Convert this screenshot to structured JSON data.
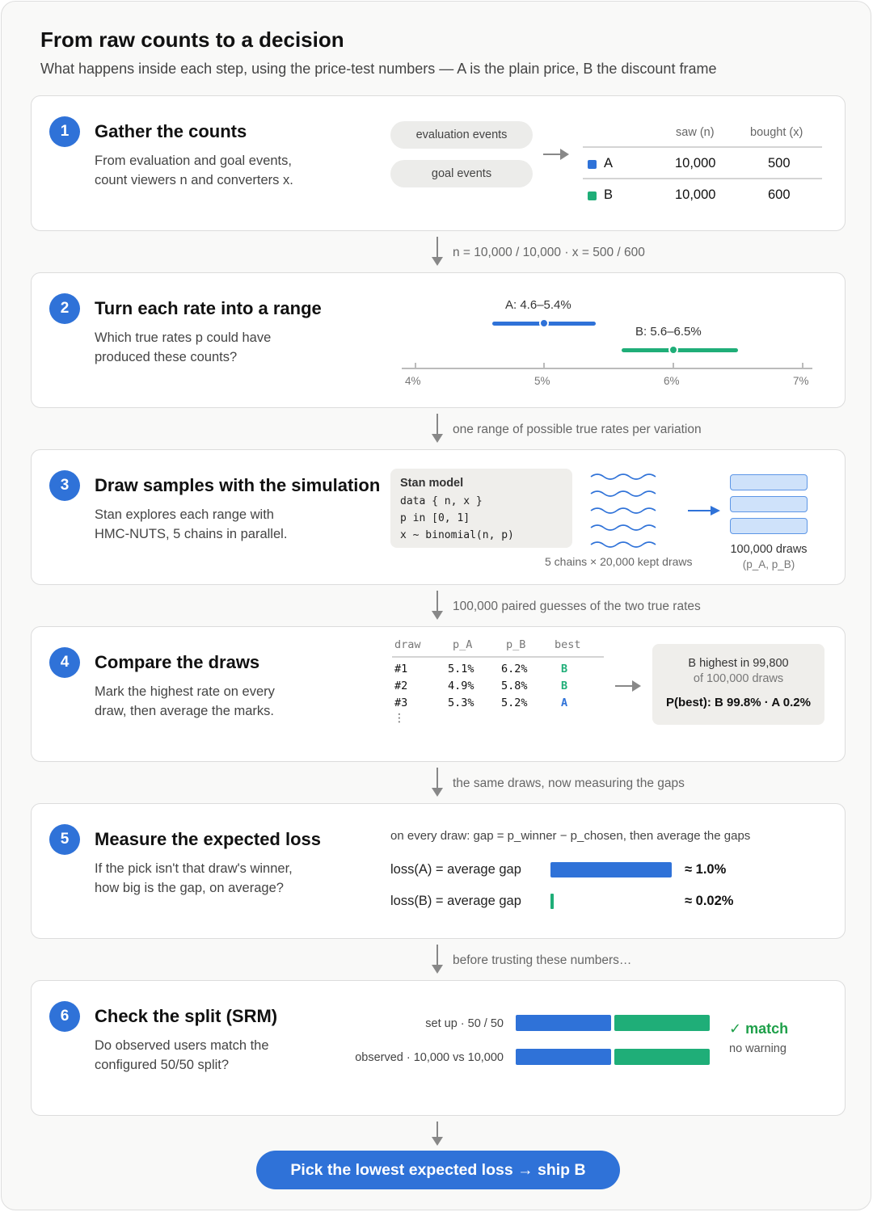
{
  "title": "From raw counts to a decision",
  "subtitle": "What happens inside each step, using the price-test numbers — A is the plain price, B the discount frame",
  "colors": {
    "accent": "#2f72d8",
    "variant_a": "#2f72d8",
    "variant_b": "#1fae78",
    "match": "#1fa04a"
  },
  "steps": [
    {
      "number": "1",
      "title": "Gather the counts",
      "desc": [
        "From evaluation and goal events,",
        "count viewers n and converters x."
      ],
      "sources": [
        "evaluation events",
        "goal events"
      ],
      "table": {
        "headers": [
          "saw (n)",
          "bought (x)"
        ],
        "rows": [
          {
            "variant": "A",
            "n": "10,000",
            "x": "500"
          },
          {
            "variant": "B",
            "n": "10,000",
            "x": "600"
          }
        ]
      }
    },
    {
      "number": "2",
      "title": "Turn each rate into a range",
      "desc": [
        "Which true rates p could have",
        "produced these counts?"
      ],
      "intervals": [
        {
          "label": "A: 4.6–5.4%",
          "low": 4.6,
          "mid": 5.0,
          "high": 5.4
        },
        {
          "label": "B: 5.6–6.5%",
          "low": 5.6,
          "mid": 6.0,
          "high": 6.5
        }
      ],
      "axis": {
        "min": 4,
        "max": 7,
        "ticks": [
          "4%",
          "5%",
          "6%",
          "7%"
        ]
      }
    },
    {
      "number": "3",
      "title": "Draw samples with the simulation",
      "desc": [
        "Stan explores each range with",
        "HMC-NUTS, 5 chains in parallel."
      ],
      "code_title": "Stan model",
      "code": [
        "data { n, x }",
        "p in [0, 1]",
        "x ~ binomial(n, p)"
      ],
      "chains_caption": "5 chains × 20,000 kept draws",
      "draws_caption": "100,000 draws",
      "draws_sub": "(p_A, p_B)"
    },
    {
      "number": "4",
      "title": "Compare the draws",
      "desc": [
        "Mark the highest rate on every",
        "draw, then average the marks."
      ],
      "table": {
        "headers": [
          "draw",
          "p_A",
          "p_B",
          "best"
        ],
        "rows": [
          {
            "draw": "#1",
            "pa": "5.1%",
            "pb": "6.2%",
            "best": "B"
          },
          {
            "draw": "#2",
            "pa": "4.9%",
            "pb": "5.8%",
            "best": "B"
          },
          {
            "draw": "#3",
            "pa": "5.3%",
            "pb": "5.2%",
            "best": "A"
          }
        ],
        "more": "⋮"
      },
      "result_line1": "B highest in 99,800",
      "result_line2": "of 100,000 draws",
      "result_summary": "P(best): B 99.8% · A 0.2%"
    },
    {
      "number": "5",
      "title": "Measure the expected loss",
      "desc": [
        "If the pick isn't that draw's winner,",
        "how big is the gap, on average?"
      ],
      "formula": "on every draw: gap = p_winner − p_chosen, then average the gaps",
      "losses": [
        {
          "label": "loss(A) = average gap",
          "value": "≈ 1.0%",
          "amount": 1.0
        },
        {
          "label": "loss(B) = average gap",
          "value": "≈ 0.02%",
          "amount": 0.02
        }
      ]
    },
    {
      "number": "6",
      "title": "Check the split (SRM)",
      "desc": [
        "Do observed users match the",
        "configured 50/50 split?"
      ],
      "rows": [
        {
          "label": "set up · 50 / 50",
          "share_a": 0.5
        },
        {
          "label": "observed · 10,000 vs 10,000",
          "share_a": 0.5
        }
      ],
      "status": "✓ match",
      "status_sub": "no warning"
    }
  ],
  "connectors": [
    "n = 10,000 / 10,000 · x = 500 / 600",
    "one range of possible true rates per variation",
    "100,000 paired guesses of the two true rates",
    "the same draws, now measuring the gaps",
    "before trusting these numbers…"
  ],
  "final_button": "Pick the lowest expected loss → ship B"
}
